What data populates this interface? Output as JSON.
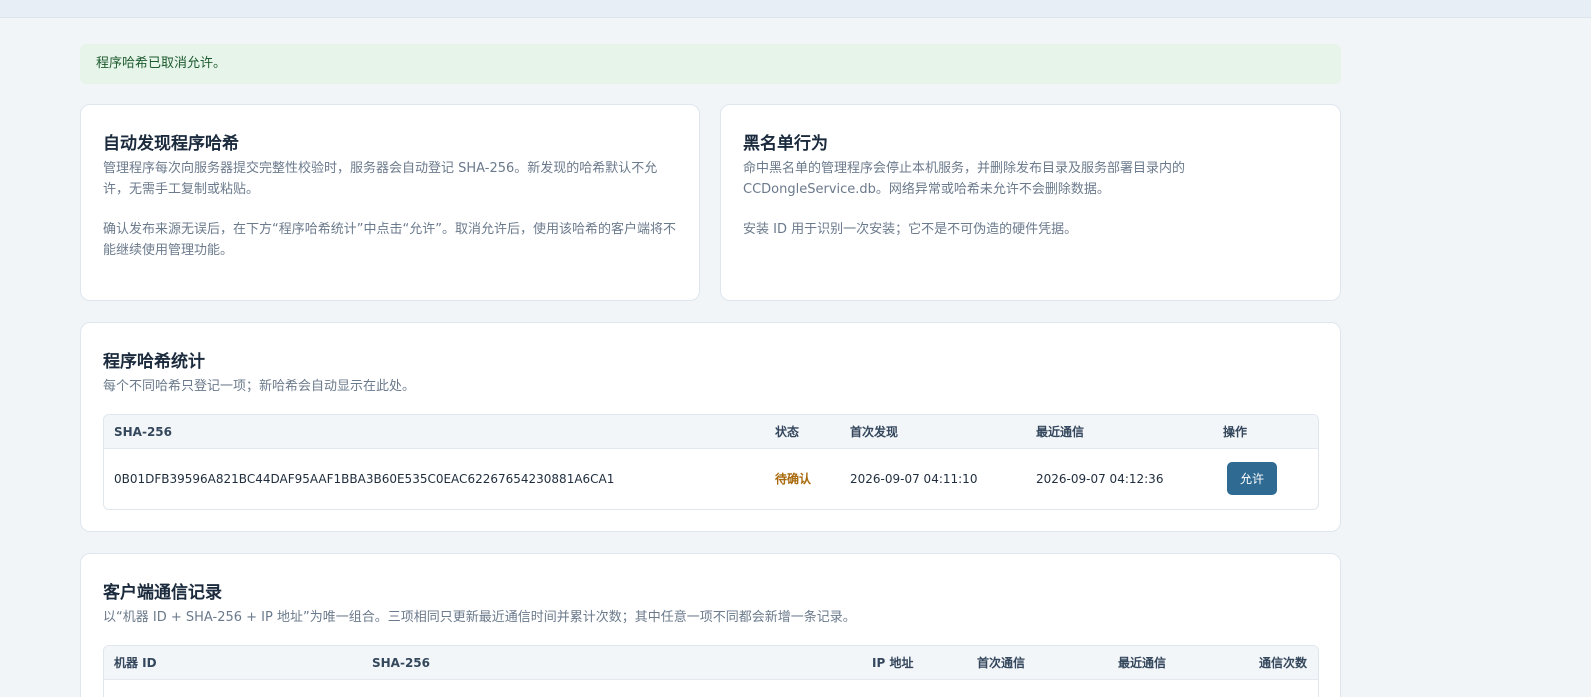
{
  "alert": {
    "text": "程序哈希已取消允许。"
  },
  "auto_discover": {
    "title": "自动发现程序哈希",
    "para1": "管理程序每次向服务器提交完整性校验时，服务器会自动登记 SHA-256。新发现的哈希默认不允许，无需手工复制或粘贴。",
    "para2": "确认发布来源无误后，在下方“程序哈希统计”中点击“允许”。取消允许后，使用该哈希的客户端将不能继续使用管理功能。"
  },
  "blacklist": {
    "title": "黑名单行为",
    "para1": "命中黑名单的管理程序会停止本机服务，并删除发布目录及服务部署目录内的 CCDongleService.db。网络异常或哈希未允许不会删除数据。",
    "para2": "安装 ID 用于识别一次安装；它不是不可伪造的硬件凭据。"
  },
  "hash_stats": {
    "title": "程序哈希统计",
    "subtitle": "每个不同哈希只登记一项；新哈希会自动显示在此处。",
    "columns": [
      "SHA-256",
      "状态",
      "首次发现",
      "最近通信",
      "操作"
    ],
    "rows": [
      {
        "sha256": "0B01DFB39596A821BC44DAF95AAF1BBA3B60E535C0EAC62267654230881A6CA1",
        "status": "待确认",
        "first_seen": "2026-09-07 04:11:10",
        "last_seen": "2026-09-07 04:12:36",
        "action": "允许"
      }
    ]
  },
  "client_log": {
    "title": "客户端通信记录",
    "subtitle": "以“机器 ID + SHA-256 + IP 地址”为唯一组合。三项相同只更新最近通信时间并累计次数；其中任意一项不同都会新增一条记录。",
    "columns": [
      "机器 ID",
      "SHA-256",
      "IP 地址",
      "首次通信",
      "最近通信",
      "通信次数"
    ]
  }
}
